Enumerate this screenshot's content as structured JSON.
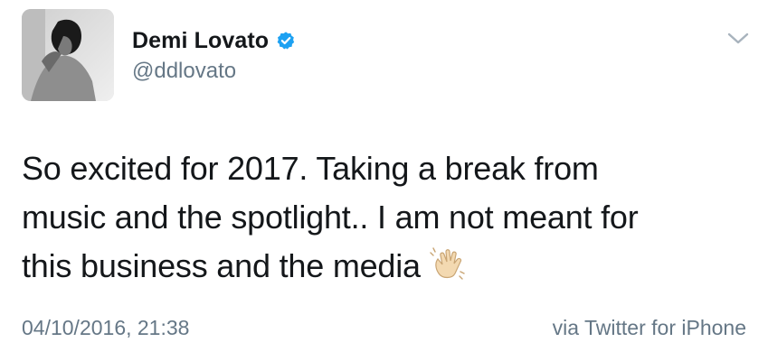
{
  "user": {
    "display_name": "Demi Lovato",
    "handle": "@ddlovato",
    "verified": true,
    "avatar_icon": "avatar-photo"
  },
  "menu": {
    "icon": "chevron-down-icon"
  },
  "tweet": {
    "line1": "So excited for 2017. Taking a break from",
    "line2": "music and the spotlight.. I am not meant for",
    "line3": "this business and the media",
    "emoji": "waving-hand-icon"
  },
  "meta": {
    "timestamp": "04/10/2016, 21:38",
    "source": "via Twitter for iPhone"
  },
  "colors": {
    "text": "#14171a",
    "muted": "#657786",
    "verified": "#1da1f2"
  }
}
